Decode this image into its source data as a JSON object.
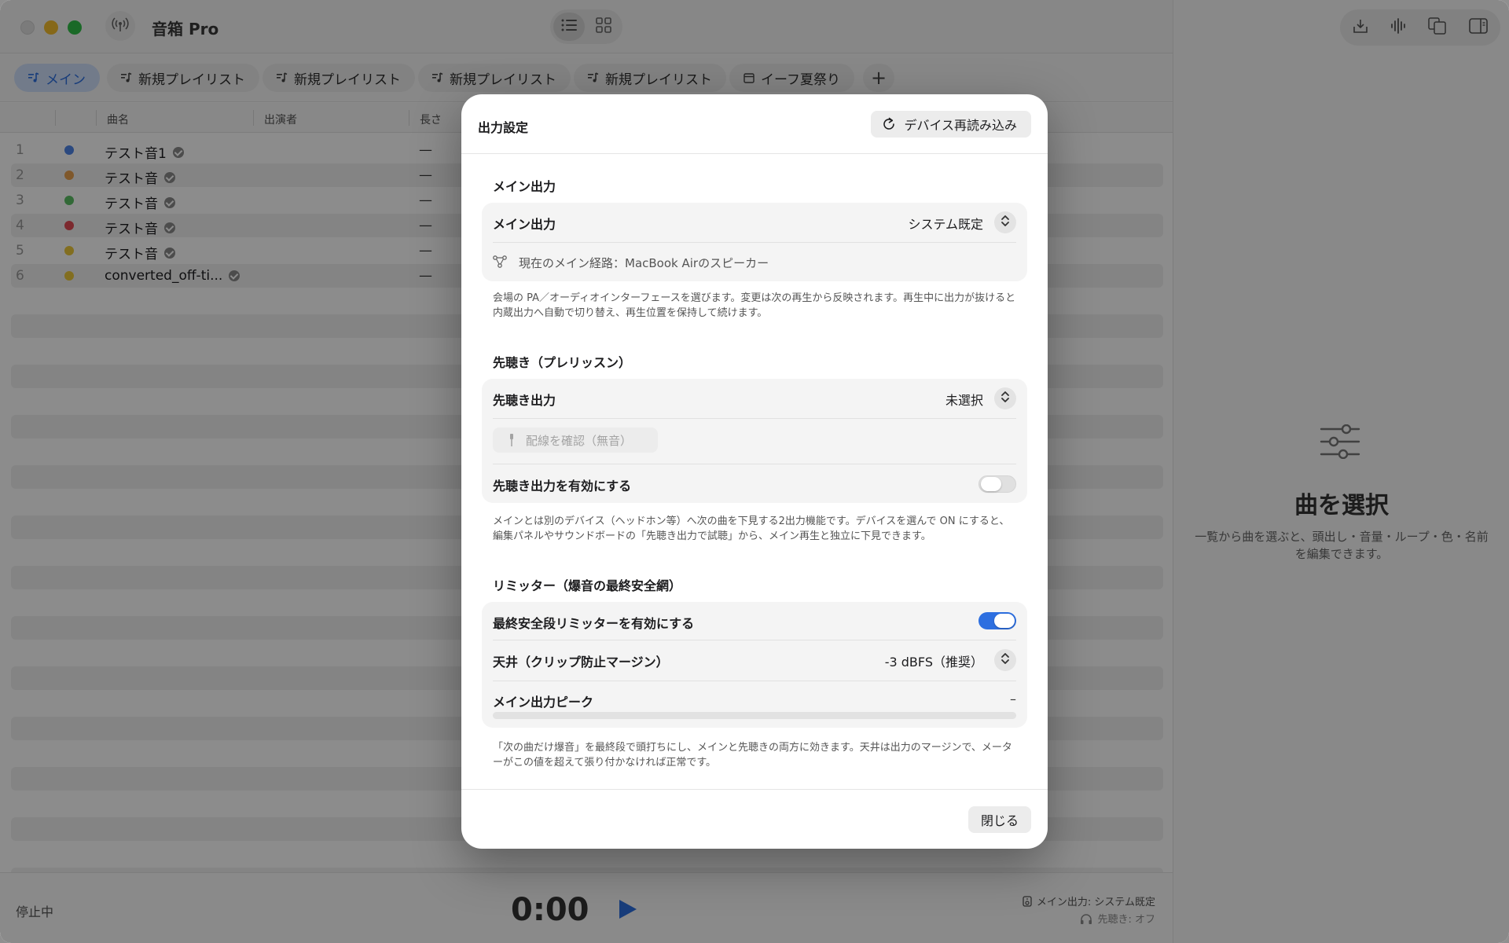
{
  "app": {
    "title": "音箱 Pro"
  },
  "tabs": [
    {
      "label": "メイン",
      "icon": "music-list-icon",
      "active": true
    },
    {
      "label": "新規プレイリスト",
      "icon": "music-list-icon"
    },
    {
      "label": "新規プレイリスト",
      "icon": "music-list-icon"
    },
    {
      "label": "新規プレイリスト",
      "icon": "music-list-icon"
    },
    {
      "label": "新規プレイリスト",
      "icon": "music-list-icon"
    },
    {
      "label": "イーフ夏祭り",
      "icon": "calendar-icon"
    }
  ],
  "table": {
    "headers": {
      "title": "曲名",
      "artist": "出演者",
      "length": "長さ"
    },
    "rows": [
      {
        "num": "1",
        "color": "#4f86e8",
        "title": "テスト音1",
        "length": "—"
      },
      {
        "num": "2",
        "color": "#e8a04f",
        "title": "テスト音",
        "length": "—"
      },
      {
        "num": "3",
        "color": "#5cc064",
        "title": "テスト音",
        "length": "—"
      },
      {
        "num": "4",
        "color": "#e24c55",
        "title": "テスト音",
        "length": "—"
      },
      {
        "num": "5",
        "color": "#edc93b",
        "title": "テスト音",
        "length": "—"
      },
      {
        "num": "6",
        "color": "#edc93b",
        "title": "converted_off-ti...",
        "length": "—"
      }
    ]
  },
  "status": {
    "state": "停止中",
    "time": "0:00",
    "main_output": "メイン出力: システム既定",
    "preview": "先聴き: オフ"
  },
  "right_panel": {
    "empty_title": "曲を選択",
    "empty_desc": "一覧から曲を選ぶと、頭出し・音量・ループ・色・名前を編集できます。"
  },
  "modal": {
    "title": "出力設定",
    "reload_label": "デバイス再読み込み",
    "main": {
      "section": "メイン出力",
      "label": "メイン出力",
      "value": "システム既定",
      "route": "現在のメイン経路：MacBook Airのスピーカー",
      "desc": "会場の PA／オーディオインターフェースを選びます。変更は次の再生から反映されます。再生中に出力が抜けると内蔵出力へ自動で切り替え、再生位置を保持して続けます。"
    },
    "preview": {
      "section": "先聴き（プレリッスン）",
      "label": "先聴き出力",
      "value": "未選択",
      "check_label": "配線を確認（無音）",
      "enable_label": "先聴き出力を有効にする",
      "enabled": false,
      "desc": "メインとは別のデバイス（ヘッドホン等）へ次の曲を下見する2出力機能です。デバイスを選んで ON にすると、編集パネルやサウンドボードの「先聴き出力で試聴」から、メイン再生と独立に下見できます。"
    },
    "limiter": {
      "section": "リミッター（爆音の最終安全網）",
      "enable_label": "最終安全段リミッターを有効にする",
      "enabled": true,
      "ceiling_label": "天井（クリップ防止マージン）",
      "ceiling_value": "-3 dBFS（推奨）",
      "peak_label": "メイン出力ピーク",
      "peak_value": "–",
      "peak_level": 0,
      "desc": "「次の曲だけ爆音」を最終段で頭打ちにし、メインと先聴きの両方に効きます。天井は出力のマージンで、メーターがこの値を超えて張り付かなければ正常です。"
    },
    "close_label": "閉じる"
  },
  "colors": {
    "accent": "#2d6fe0",
    "active_tab_bg": "#cfe0fb"
  }
}
